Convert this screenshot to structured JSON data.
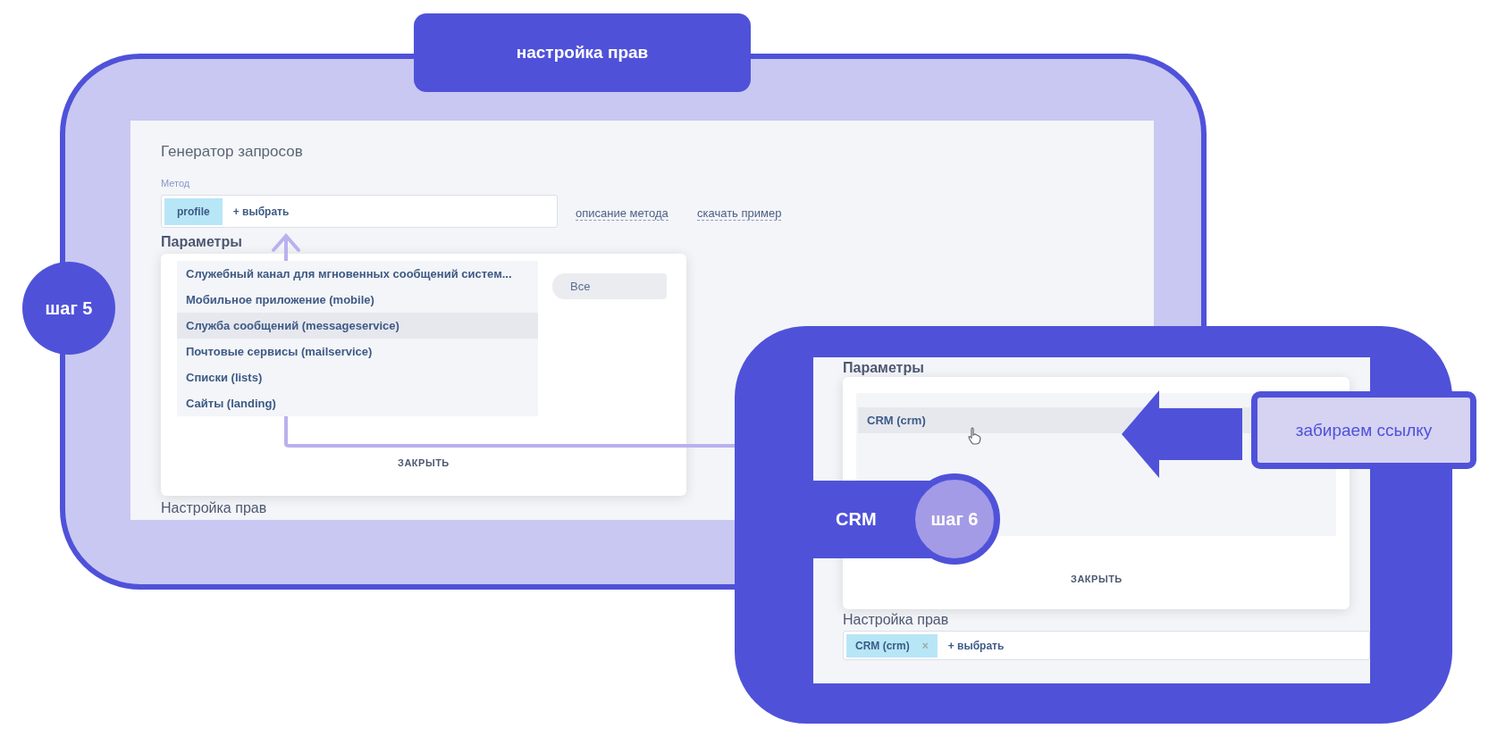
{
  "header_tab": {
    "label": "настройка прав"
  },
  "step5": {
    "label": "шаг 5"
  },
  "screen1": {
    "title": "Генератор запросов",
    "method_label": "Метод",
    "method_chip": "profile",
    "add_label": "+ выбрать",
    "links": [
      "описание метода",
      "скачать пример"
    ],
    "params_heading": "Параметры",
    "dropdown": {
      "items": [
        {
          "label": "Служебный канал для мгновенных сообщений систем...",
          "selected": false
        },
        {
          "label": "Мобильное приложение (mobile)",
          "selected": false
        },
        {
          "label": "Служба сообщений (messageservice)",
          "selected": true
        },
        {
          "label": "Почтовые сервисы (mailservice)",
          "selected": false
        },
        {
          "label": "Списки (lists)",
          "selected": false
        },
        {
          "label": "Сайты (landing)",
          "selected": false
        }
      ],
      "filter": "Все",
      "close": "ЗАКРЫТЬ"
    },
    "rights_heading": "Настройка прав"
  },
  "screen2": {
    "params_heading": "Параметры",
    "dropdown": {
      "items": [
        {
          "label": "CRM (crm)",
          "selected": true
        }
      ],
      "close": "ЗАКРЫТЬ"
    },
    "rights_heading": "Настройка прав",
    "chip": "CRM (crm)",
    "chip_remove": "×",
    "add_label": "+ выбрать"
  },
  "callout": {
    "label": "забираем ссылку"
  },
  "step6": {
    "tag": "CRM",
    "label": "шаг 6"
  }
}
